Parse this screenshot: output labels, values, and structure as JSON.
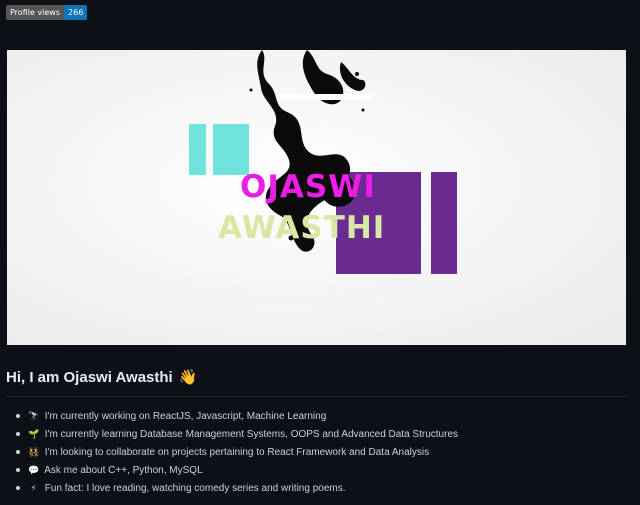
{
  "badge": {
    "label": "Profile views",
    "count": "266"
  },
  "banner": {
    "first_name": "OJASWI",
    "last_name": "AWASTHI"
  },
  "intro": {
    "heading": "Hi, I am Ojaswi Awasthi",
    "wave_icon": "👋"
  },
  "items": [
    {
      "icon": "🔭",
      "icon_name": "telescope-icon",
      "text": "I'm currently working on ReactJS, Javascript, Machine Learning"
    },
    {
      "icon": "🌱",
      "icon_name": "seedling-icon",
      "text": "I'm currently learning Database Management Systems, OOPS and Advanced Data Structures"
    },
    {
      "icon": "👯",
      "icon_name": "dancers-icon",
      "text": "I'm looking to collaborate on projects pertaining to React Framework and Data Analysis"
    },
    {
      "icon": "💬",
      "icon_name": "speech-bubble-icon",
      "text": "Ask me about C++, Python, MySQL"
    },
    {
      "icon": "⚡",
      "icon_name": "lightning-icon",
      "text": "Fun fact: I love reading, watching comedy series and writing poems."
    }
  ],
  "colors": {
    "page_bg": "#0d1117",
    "badge_value_bg": "#0e75b6",
    "first_name": "#ea1ee6",
    "last_name": "#d8e8a4",
    "cyan_block": "#6fe3dc",
    "purple_block": "#6b2c91"
  }
}
